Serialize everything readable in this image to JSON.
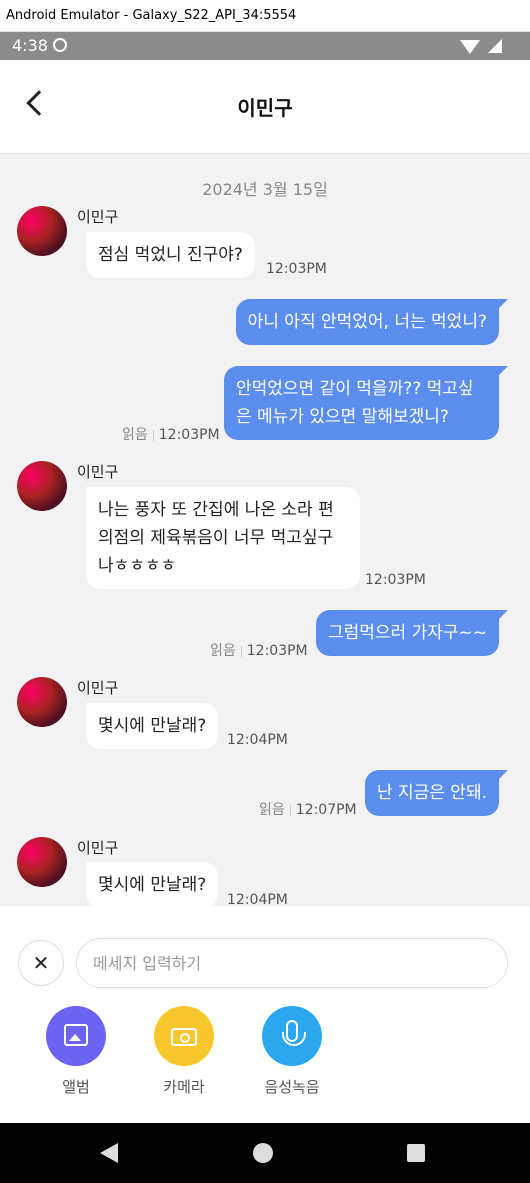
{
  "window": {
    "title": "Android Emulator - Galaxy_S22_API_34:5554"
  },
  "status": {
    "time": "4:38"
  },
  "header": {
    "title": "이민구"
  },
  "chat": {
    "date": "2024년 3월 15일",
    "messages": [
      {
        "dir": "in",
        "sender": "이민구",
        "text": "점심 먹었니 진구야?",
        "time": "12:03PM"
      },
      {
        "dir": "out",
        "text": "아니 아직 안먹었어, 너는 먹었니?",
        "read": "",
        "time": ""
      },
      {
        "dir": "out",
        "text": "안먹었으면 같이 먹을까?? 먹고싶은 메뉴가 있으면 말해보겠니?",
        "read": "읽음",
        "time": "12:03PM"
      },
      {
        "dir": "in",
        "sender": "이민구",
        "text": "나는 풍자 또 간집에 나온 소라 편의점의 제육볶음이 너무 먹고싶구나ㅎㅎㅎㅎ",
        "time": "12:03PM"
      },
      {
        "dir": "out",
        "text": "그럼먹으러 가자구~~",
        "read": "읽음",
        "time": "12:03PM"
      },
      {
        "dir": "in",
        "sender": "이민구",
        "text": "몇시에 만날래?",
        "time": "12:04PM"
      },
      {
        "dir": "out",
        "text": "난 지금은 안돼.",
        "read": "읽음",
        "time": "12:07PM"
      },
      {
        "dir": "in",
        "sender": "이민구",
        "text": "몇시에 만날래?",
        "time": "12:04PM"
      }
    ]
  },
  "composer": {
    "close_glyph": "✕",
    "placeholder": "메세지 입력하기",
    "value": "",
    "actions": [
      {
        "label": "앨범",
        "icon": "album-icon",
        "color": "#6b63f2"
      },
      {
        "label": "카메라",
        "icon": "camera-icon",
        "color": "#f8c72b"
      },
      {
        "label": "음성녹음",
        "icon": "microphone-icon",
        "color": "#2aa7ee"
      }
    ]
  },
  "colors": {
    "outgoing_bubble": "#5b8dee",
    "chat_background": "#f2f2f2"
  }
}
